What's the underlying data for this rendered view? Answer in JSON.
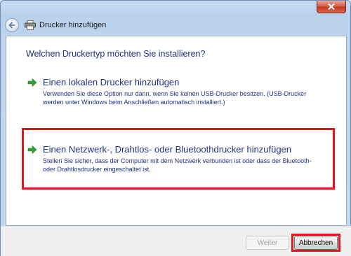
{
  "window": {
    "title": "Drucker hinzufügen",
    "icons": {
      "back": "back-arrow-icon",
      "printer": "printer-icon",
      "close": "close-icon"
    }
  },
  "heading": "Welchen Druckertyp möchten Sie installieren?",
  "options": [
    {
      "icon": "green-arrow-icon",
      "title": "Einen lokalen Drucker hinzufügen",
      "desc_line1": "Verwenden Sie diese Option nur dann, wenn Sie keinen USB-Drucker besitzen. (USB-Drucker",
      "desc_line2": "werden unter Windows beim Anschließen automatisch installiert.)"
    },
    {
      "icon": "green-arrow-icon",
      "title": "Einen Netzwerk-, Drahtlos- oder Bluetoothdrucker hinzufügen",
      "desc_line1": "Stellen Sie sicher, dass der Computer mit dem Netzwerk verbunden ist oder dass der Bluetooth-",
      "desc_line2": "oder Drahtlosdrucker eingeschaltet ist.",
      "highlighted": true
    }
  ],
  "footer": {
    "next_label": "Weiter",
    "next_enabled": false,
    "cancel_label": "Abbrechen"
  },
  "colors": {
    "highlight": "#e3141c",
    "link_text": "#1e3287",
    "arrow": "#2fa535"
  }
}
